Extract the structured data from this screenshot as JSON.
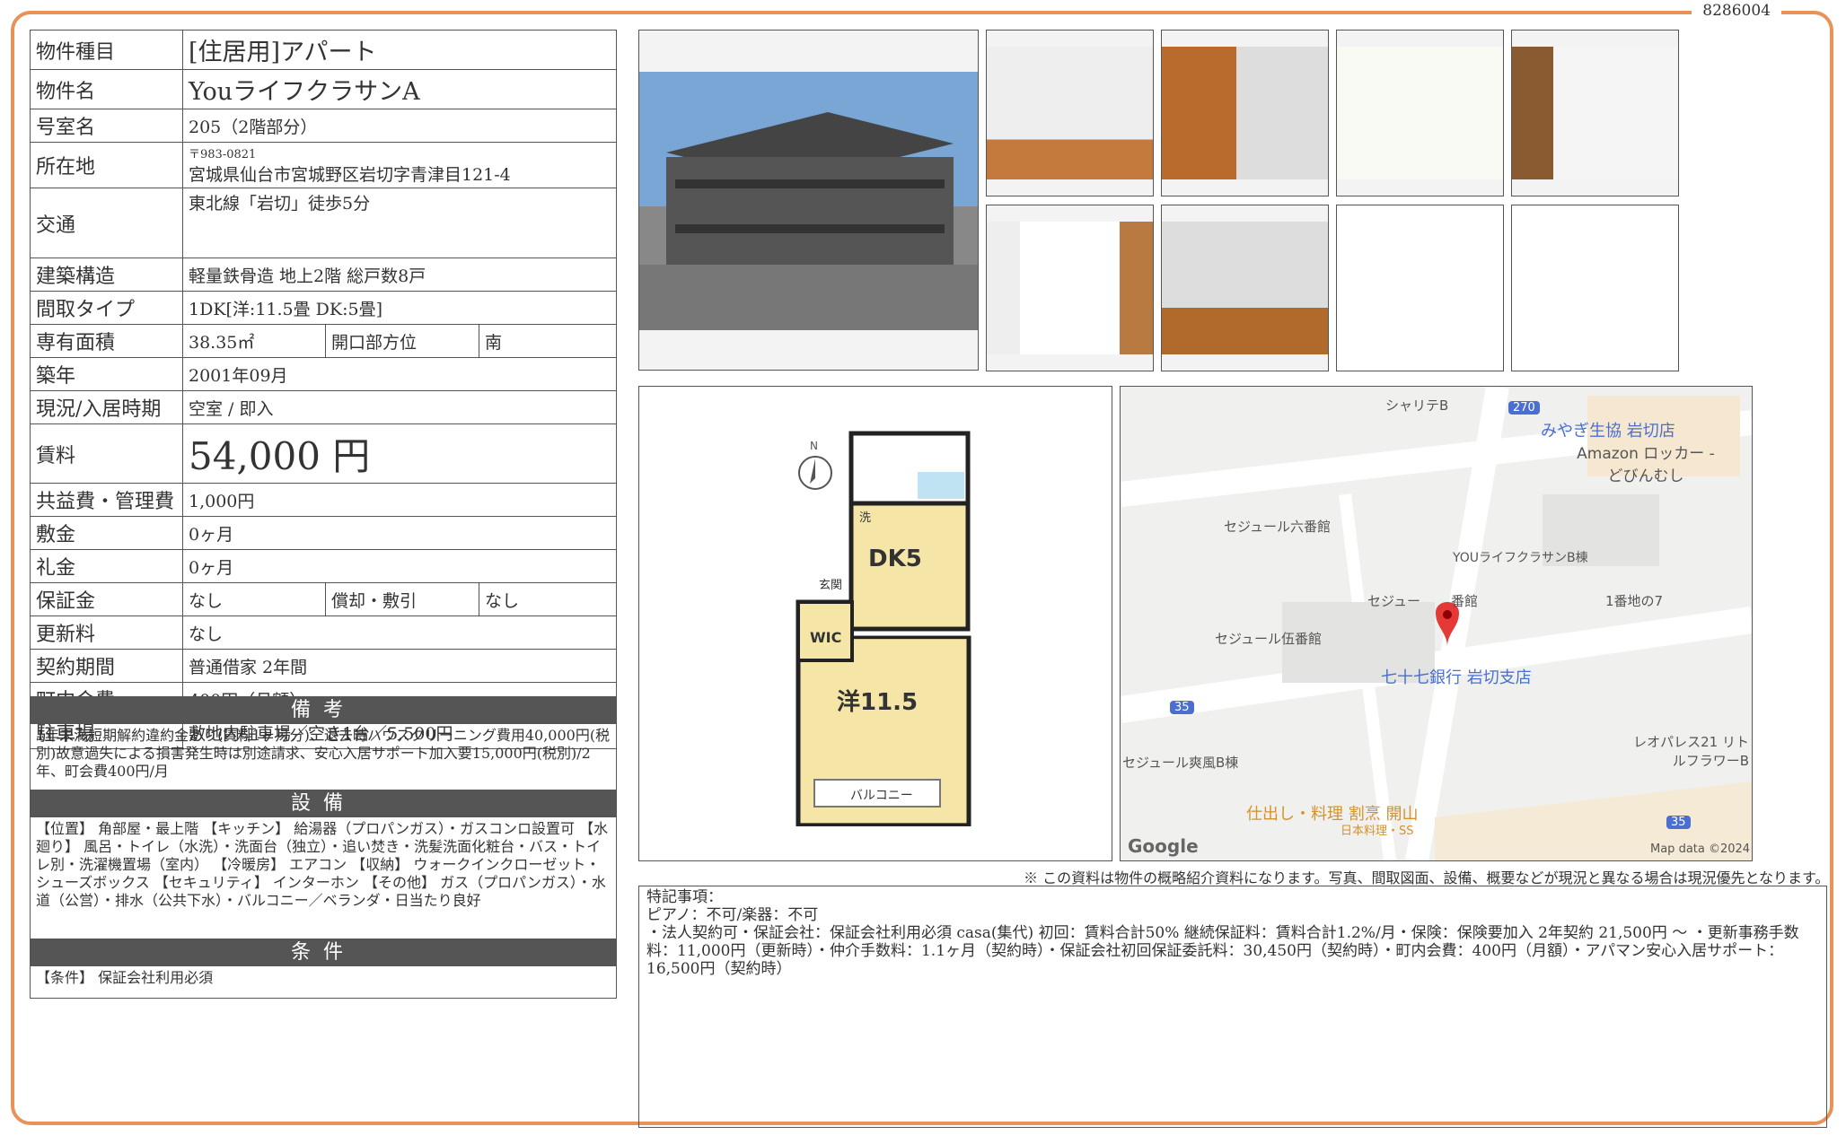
{
  "doc_id": "8286004",
  "spec": {
    "type_label": "物件種目",
    "type_value": "[住居用]アパート",
    "name_label": "物件名",
    "name_value": "YouライフクラサンA",
    "room_label": "号室名",
    "room_value": "205（2階部分）",
    "addr_label": "所在地",
    "addr_zip": "〒983-0821",
    "addr_value": "宮城県仙台市宮城野区岩切字青津目121-4",
    "access_label": "交通",
    "access_value": "東北線「岩切」徒歩5分",
    "struct_label": "建築構造",
    "struct_value": "軽量鉄骨造 地上2階 総戸数8戸",
    "layout_label": "間取タイプ",
    "layout_value": "1DK[洋:11.5畳 DK:5畳]",
    "area_label": "専有面積",
    "area_value": "38.35㎡",
    "facing_label": "開口部方位",
    "facing_value": "南",
    "built_label": "築年",
    "built_value": "2001年09月",
    "status_label": "現況/入居時期",
    "status_value": "空室 / 即入",
    "rent_label": "賃料",
    "rent_value": "54,000 円",
    "fee_label": "共益費・管理費",
    "fee_value": "1,000円",
    "deposit_label": "敷金",
    "deposit_value": "0ヶ月",
    "key_label": "礼金",
    "key_value": "0ヶ月",
    "guar_label": "保証金",
    "guar_value": "なし",
    "amort_label": "償却・敷引",
    "amort_value": "なし",
    "renew_label": "更新料",
    "renew_value": "なし",
    "term_label": "契約期間",
    "term_value": "普通借家 2年間",
    "town_label": "町内会費",
    "town_value": "400円（月額）",
    "park_label": "駐車場",
    "park_value": "敷地内駐車場／空き1台／5,500円"
  },
  "notes": {
    "header": "備考",
    "text": "1年未満短期解約違約金あり(賃料1ヶ月分)、退去時ハウスクリーニング費用40,000円(税別)故意過失による損害発生時は別途請求、安心入居サポート加入要15,000円(税別)/2年、町会費400円/月"
  },
  "equipment": {
    "header": "設備",
    "text": "【位置】 角部屋・最上階 【キッチン】 給湯器（プロパンガス）・ガスコンロ設置可 【水廻り】 風呂・トイレ（水洗）・洗面台（独立）・追い焚き・洗髪洗面化粧台・バス・トイレ別・洗濯機置場（室内） 【冷暖房】 エアコン 【収納】 ウォークインクローゼット・シューズボックス 【セキュリティ】 インターホン 【その他】 ガス（プロパンガス）・水道（公営）・排水（公共下水）・バルコニー／ベランダ・日当たり良好"
  },
  "conditions": {
    "header": "条件",
    "text": "【条件】 保証会社利用必須"
  },
  "floorplan": {
    "north": "N",
    "dk": "DK5",
    "wic": "WIC",
    "western": "洋11.5",
    "balcony": "バルコニー",
    "entrance": "玄関",
    "wash": "洗"
  },
  "map": {
    "labels": [
      "シャリテB",
      "270",
      "みやぎ生協 岩切店",
      "Amazon ロッカー - どびんむし",
      "セジュール六番館",
      "YOUライフクラサンB棟",
      "セジュー",
      "番館",
      "1番地の7",
      "セジュール伍番館",
      "七十七銀行 岩切支店",
      "35",
      "レオパレス21 リトルフラワーB",
      "セジュール爽風B棟",
      "仕出し・料理 割烹 開山",
      "日本料理・SS",
      "Google",
      "Map data ©2024",
      "35"
    ]
  },
  "notice": "※ この資料は物件の概略紹介資料になります。写真、間取図面、設備、概要などが現況と異なる場合は現況優先となります。",
  "remarks": {
    "title": "特記事項：",
    "line1": "ピアノ：不可/楽器：不可",
    "line2": "・法人契約可・保証会社：保証会社利用必須 casa(集代) 初回：賃料合計50% 継続保証料：賃料合計1.2%/月・保険：保険要加入 2年契約 21,500円 〜 ・更新事務手数料：11,000円（更新時）・仲介手数料：1.1ヶ月（契約時）・保証会社初回保証委託料：30,450円（契約時）・町内会費：400円（月額）・アパマン安心入居サポート：16,500円（契約時）"
  },
  "colors": {
    "frame": "#e8925a",
    "header_bg": "#555555"
  }
}
